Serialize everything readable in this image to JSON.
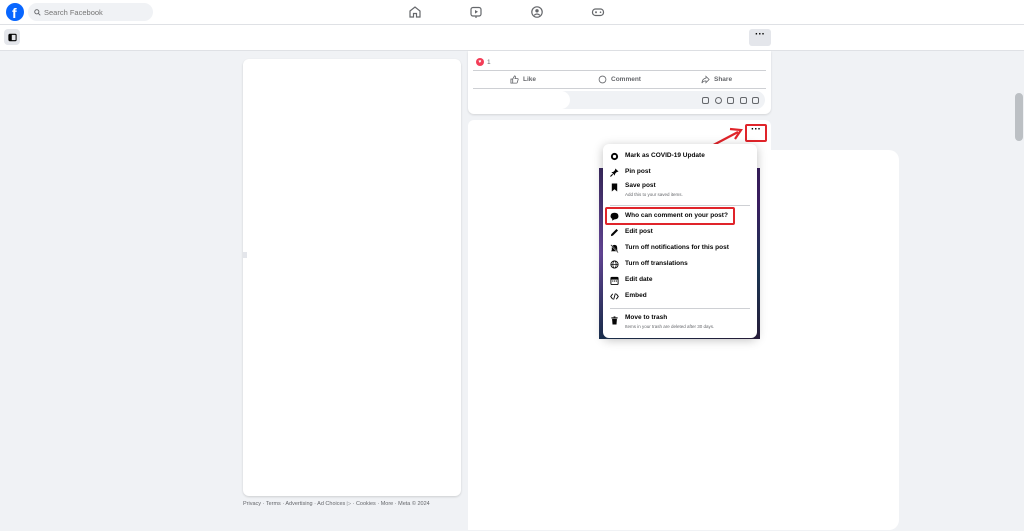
{
  "topbar": {
    "search_placeholder": "Search Facebook"
  },
  "post1": {
    "reaction_count": "1",
    "like_label": "Like",
    "comment_label": "Comment",
    "share_label": "Share"
  },
  "menu": {
    "items": [
      {
        "label": "Mark as COVID-19 Update",
        "icon": "covid-icon"
      },
      {
        "label": "Pin post",
        "icon": "pin-icon"
      },
      {
        "label": "Save post",
        "sub": "Add this to your saved items.",
        "icon": "bookmark-icon"
      },
      {
        "label": "Who can comment on your post?",
        "icon": "comment-bubble-icon"
      },
      {
        "label": "Edit post",
        "icon": "pencil-icon"
      },
      {
        "label": "Turn off notifications for this post",
        "icon": "bell-off-icon"
      },
      {
        "label": "Turn off translations",
        "icon": "translate-icon"
      },
      {
        "label": "Edit date",
        "icon": "calendar-icon"
      },
      {
        "label": "Embed",
        "icon": "code-icon"
      },
      {
        "label": "Move to trash",
        "sub": "Items in your trash are deleted after 30 days.",
        "icon": "trash-icon"
      }
    ]
  },
  "footer": {
    "text": "Privacy · Terms · Advertising · Ad Choices ▷ · Cookies · More · Meta © 2024"
  },
  "colors": {
    "brand": "#0866ff",
    "annotation_red": "#e0242a",
    "background": "#f0f2f5"
  }
}
